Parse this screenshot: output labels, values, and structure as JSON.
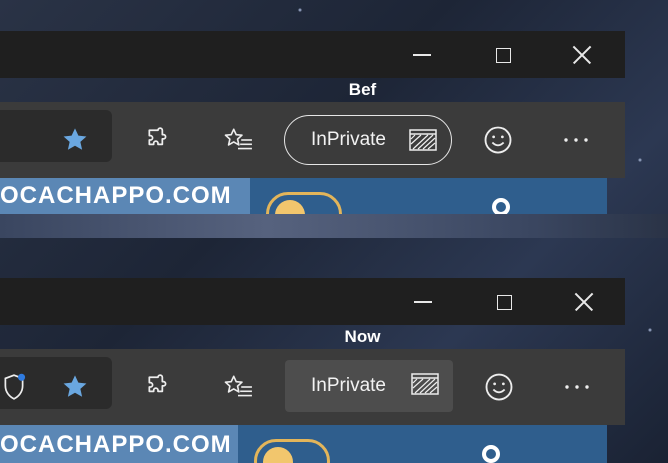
{
  "before": {
    "caption": "Bef",
    "toolbar": {
      "inprivate_label": "InPrivate"
    },
    "content": {
      "site_text": "OCACHAPPO.COM"
    }
  },
  "now": {
    "caption": "Now",
    "toolbar": {
      "inprivate_label": "InPrivate"
    },
    "content": {
      "site_text": "OCACHAPPO.COM"
    }
  },
  "icons": {
    "minimize": "minimize-icon",
    "maximize": "maximize-icon",
    "close": "close-icon",
    "favorite_star": "star-icon",
    "extensions": "puzzle-icon",
    "favorites": "favorites-list-icon",
    "inprivate": "inprivate-icon",
    "feedback": "smiley-icon",
    "more": "ellipsis-icon",
    "tracking": "shield-icon"
  },
  "colors": {
    "titlebar": "#1f1f1f",
    "toolbar": "#3b3b3b",
    "star": "#6aa7e0",
    "accent_dot": "#2f7be0",
    "toggle": "#e3b55a"
  }
}
